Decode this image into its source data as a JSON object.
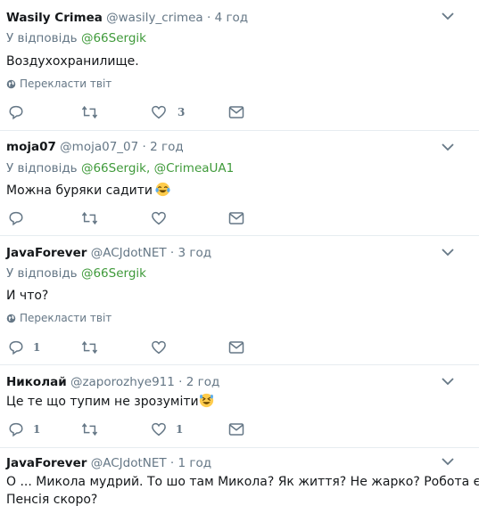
{
  "tweets": [
    {
      "name": "Wasily Crimea",
      "handle": "@wasily_crimea",
      "time": "· 4 год",
      "reply_prefix": "У відповідь",
      "reply_to": [
        "@66Sergik"
      ],
      "text": "Воздухохранилище.",
      "translate": "Перекласти твіт",
      "reply_count": "",
      "retweet_count": "",
      "like_count": "3"
    },
    {
      "name": "moja07",
      "handle": "@moja07_07",
      "time": "· 2 год",
      "reply_prefix": "У відповідь",
      "reply_to": [
        "@66Sergik",
        "@CrimeaUA1"
      ],
      "text": "Можна буряки садити",
      "translate": "",
      "reply_count": "",
      "retweet_count": "",
      "like_count": ""
    },
    {
      "name": "JavaForever",
      "handle": "@ACJdotNET",
      "time": "· 3 год",
      "reply_prefix": "У відповідь",
      "reply_to": [
        "@66Sergik"
      ],
      "text": "И что?",
      "translate": "Перекласти твіт",
      "reply_count": "1",
      "retweet_count": "",
      "like_count": ""
    },
    {
      "name": "Николай",
      "handle": "@zaporozhye911",
      "time": "· 2 год",
      "text": "Це те що тупим не зрозуміти",
      "reply_count": "1",
      "retweet_count": "",
      "like_count": "1"
    },
    {
      "name": "JavaForever",
      "handle": "@ACJdotNET",
      "time": "· 1 год",
      "text_line1": "О ...  Микола мудрий. То шо там  Микола? Як життя? Не жарко? Робота є?",
      "text_line2": "Пенсія скоро?"
    }
  ]
}
